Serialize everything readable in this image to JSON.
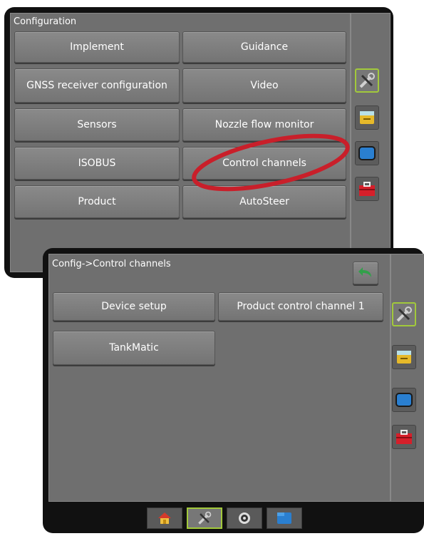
{
  "config_screen": {
    "title": "Configuration",
    "buttons": [
      "Implement",
      "Guidance",
      "GNSS receiver configuration",
      "Video",
      "Sensors",
      "Nozzle flow monitor",
      "ISOBUS",
      "Control channels",
      "Product",
      "AutoSteer"
    ]
  },
  "sub_screen": {
    "title": "Config->Control channels",
    "buttons": [
      "Device setup",
      "Product control channel 1",
      "TankMatic"
    ]
  },
  "side_icons": [
    "tools-icon",
    "tank-icon",
    "console-icon",
    "toolbox-icon"
  ],
  "bottom_tabs": [
    "home-icon",
    "tools-icon",
    "gps-icon",
    "folder-icon"
  ],
  "colors": {
    "highlight": "#a2c93b",
    "annotation": "#c91f2a",
    "back_arrow": "#32a04a"
  }
}
